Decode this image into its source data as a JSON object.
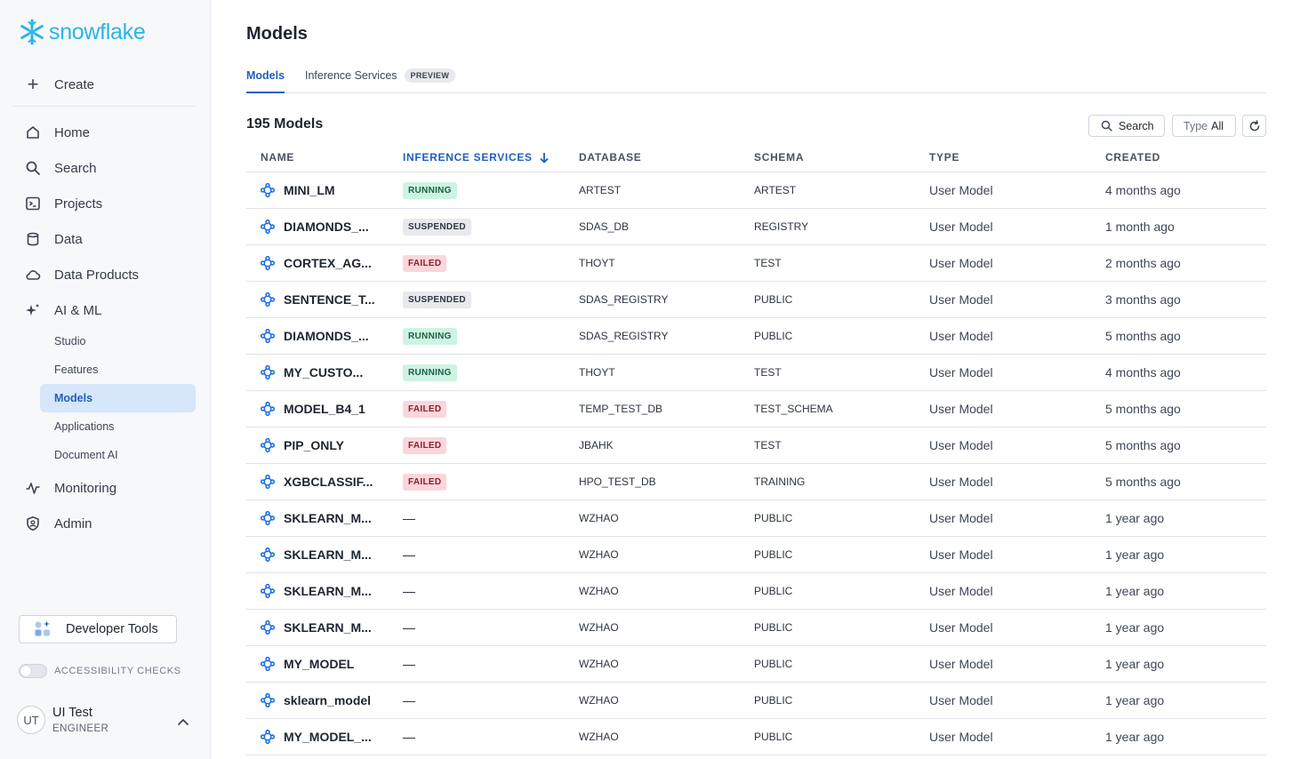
{
  "brand": {
    "name": "snowflake",
    "color": "#29b5e8"
  },
  "sidebar": {
    "create_label": "Create",
    "nav": [
      {
        "label": "Home",
        "icon": "home-icon"
      },
      {
        "label": "Search",
        "icon": "search-icon"
      },
      {
        "label": "Projects",
        "icon": "projects-icon"
      },
      {
        "label": "Data",
        "icon": "database-icon"
      },
      {
        "label": "Data Products",
        "icon": "cloud-icon"
      },
      {
        "label": "AI & ML",
        "icon": "sparkle-icon"
      }
    ],
    "ai_ml_items": [
      "Studio",
      "Features",
      "Models",
      "Applications",
      "Document AI"
    ],
    "active_item": "Models",
    "nav_bottom": [
      {
        "label": "Monitoring",
        "icon": "pulse-icon"
      },
      {
        "label": "Admin",
        "icon": "shield-icon"
      }
    ],
    "developer_tools_label": "Developer Tools",
    "accessibility_label": "ACCESSIBILITY CHECKS",
    "accessibility_on": false,
    "user": {
      "initials": "UT",
      "name": "UI Test",
      "role": "ENGINEER"
    }
  },
  "page": {
    "title": "Models",
    "tabs": [
      {
        "label": "Models",
        "active": true
      },
      {
        "label": "Inference Services",
        "active": false,
        "badge": "PREVIEW"
      }
    ],
    "count_title": "195 Models",
    "search_label": "Search",
    "type_filter": {
      "key": "Type",
      "value": "All"
    }
  },
  "table": {
    "columns": [
      "NAME",
      "INFERENCE SERVICES",
      "DATABASE",
      "SCHEMA",
      "TYPE",
      "CREATED"
    ],
    "sorted_column": "INFERENCE SERVICES",
    "rows": [
      {
        "name": "MINI_LM",
        "status": "RUNNING",
        "database": "ARTEST",
        "schema": "ARTEST",
        "type": "User Model",
        "created": "4 months ago"
      },
      {
        "name": "DIAMONDS_...",
        "status": "SUSPENDED",
        "database": "SDAS_DB",
        "schema": "REGISTRY",
        "type": "User Model",
        "created": "1 month ago"
      },
      {
        "name": "CORTEX_AG...",
        "status": "FAILED",
        "database": "THOYT",
        "schema": "TEST",
        "type": "User Model",
        "created": "2 months ago"
      },
      {
        "name": "SENTENCE_T...",
        "status": "SUSPENDED",
        "database": "SDAS_REGISTRY",
        "schema": "PUBLIC",
        "type": "User Model",
        "created": "3 months ago"
      },
      {
        "name": "DIAMONDS_...",
        "status": "RUNNING",
        "database": "SDAS_REGISTRY",
        "schema": "PUBLIC",
        "type": "User Model",
        "created": "5 months ago"
      },
      {
        "name": "MY_CUSTO...",
        "status": "RUNNING",
        "database": "THOYT",
        "schema": "TEST",
        "type": "User Model",
        "created": "4 months ago"
      },
      {
        "name": "MODEL_B4_1",
        "status": "FAILED",
        "database": "TEMP_TEST_DB",
        "schema": "TEST_SCHEMA",
        "type": "User Model",
        "created": "5 months ago"
      },
      {
        "name": "PIP_ONLY",
        "status": "FAILED",
        "database": "JBAHK",
        "schema": "TEST",
        "type": "User Model",
        "created": "5 months ago"
      },
      {
        "name": "XGBCLASSIF...",
        "status": "FAILED",
        "database": "HPO_TEST_DB",
        "schema": "TRAINING",
        "type": "User Model",
        "created": "5 months ago"
      },
      {
        "name": "SKLEARN_M...",
        "status": "—",
        "database": "WZHAO",
        "schema": "PUBLIC",
        "type": "User Model",
        "created": "1 year ago"
      },
      {
        "name": "SKLEARN_M...",
        "status": "—",
        "database": "WZHAO",
        "schema": "PUBLIC",
        "type": "User Model",
        "created": "1 year ago"
      },
      {
        "name": "SKLEARN_M...",
        "status": "—",
        "database": "WZHAO",
        "schema": "PUBLIC",
        "type": "User Model",
        "created": "1 year ago"
      },
      {
        "name": "SKLEARN_M...",
        "status": "—",
        "database": "WZHAO",
        "schema": "PUBLIC",
        "type": "User Model",
        "created": "1 year ago"
      },
      {
        "name": "MY_MODEL",
        "status": "—",
        "database": "WZHAO",
        "schema": "PUBLIC",
        "type": "User Model",
        "created": "1 year ago"
      },
      {
        "name": "sklearn_model",
        "status": "—",
        "database": "WZHAO",
        "schema": "PUBLIC",
        "type": "User Model",
        "created": "1 year ago"
      },
      {
        "name": "MY_MODEL_...",
        "status": "—",
        "database": "WZHAO",
        "schema": "PUBLIC",
        "type": "User Model",
        "created": "1 year ago"
      }
    ]
  },
  "colors": {
    "accent": "#1f5fbf",
    "running": "#cdf3e3",
    "suspended": "#e7e9ed",
    "failed": "#fbd6db"
  }
}
